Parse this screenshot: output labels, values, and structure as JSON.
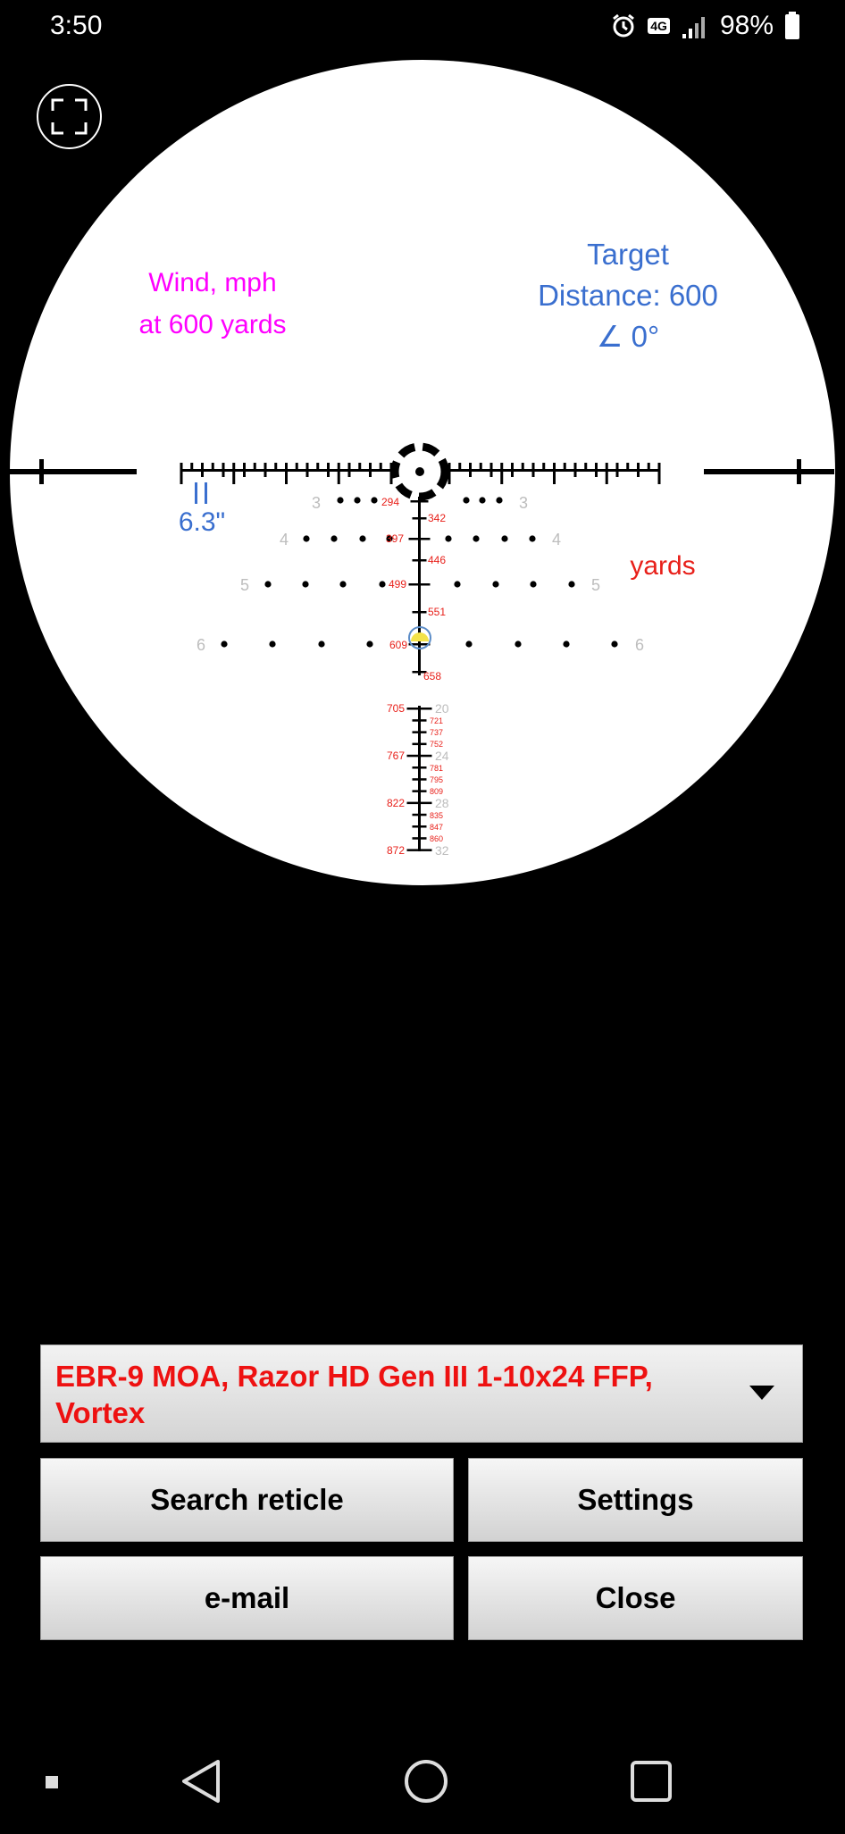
{
  "status_bar": {
    "time": "3:50",
    "network": "4G",
    "battery": "98%",
    "icons": [
      "alarm-icon",
      "network-4g-icon",
      "signal-icon",
      "battery-icon"
    ]
  },
  "scope": {
    "wind_label_line1": "Wind, mph",
    "wind_label_line2": "at 600 yards",
    "target_line1": "Target",
    "target_line2": "Distance: 600",
    "target_line3": "∠ 0°",
    "spacing_value": "6.3\"",
    "yards_label": "yards",
    "wind_marks": [
      "3",
      "3",
      "4",
      "4",
      "5",
      "5",
      "6",
      "6"
    ],
    "range_marks_upper": [
      "294",
      "342",
      "397",
      "446",
      "499",
      "551",
      "609",
      "658"
    ],
    "range_marks_lower": [
      "705",
      "721",
      "737",
      "752",
      "767",
      "781",
      "795",
      "809",
      "822",
      "835",
      "847",
      "860",
      "872"
    ],
    "moa_marks": [
      "20",
      "24",
      "28",
      "32"
    ],
    "colors": {
      "wind": "#ff00ff",
      "target": "#3a6fcf",
      "range": "#e8201a",
      "moa": "#bdbdbd"
    }
  },
  "reticle_select": {
    "value": "EBR-9 MOA, Razor HD Gen III 1-10x24 FFP, Vortex"
  },
  "buttons": {
    "search": "Search reticle",
    "settings": "Settings",
    "email": "e-mail",
    "close": "Close"
  }
}
